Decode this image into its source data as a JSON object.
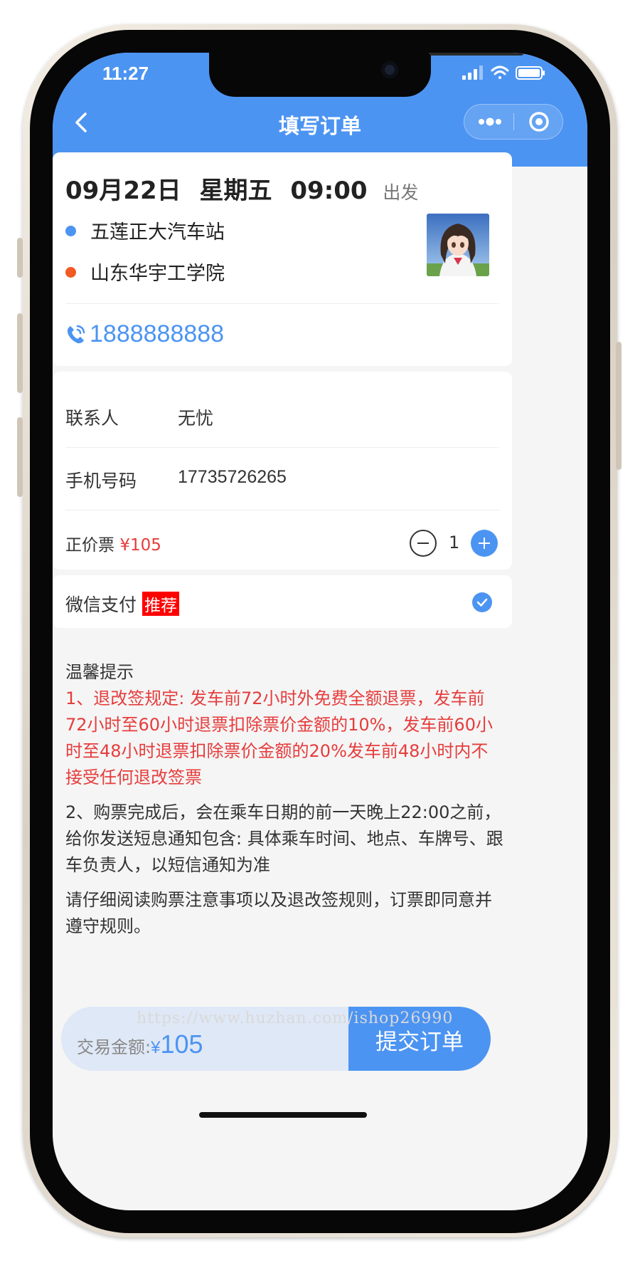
{
  "status_bar": {
    "time": "11:27"
  },
  "nav": {
    "title": "填写订单"
  },
  "trip": {
    "date": "09月22日",
    "weekday": "星期五",
    "time": "09:00",
    "depart_label": "出发",
    "origin": "五莲正大汽车站",
    "destination": "山东华宇工学院",
    "origin_color": "#4c94f2",
    "destination_color": "#f15a22",
    "service_phone": "1888888888"
  },
  "passenger": {
    "contact_label": "联系人",
    "contact_value": "无忧",
    "phone_label": "手机号码",
    "phone_value": "17735726265",
    "ticket_label": "正价票",
    "ticket_price": "¥105",
    "quantity": "1"
  },
  "payment": {
    "method": "微信支付",
    "badge": "推荐",
    "selected": true
  },
  "notice": {
    "heading": "温馨提示",
    "rule_1": "1、退改签规定: 发车前72小时外免费全额退票，发车前72小时至60小时退票扣除票价金额的10%，发车前60小时至48小时退票扣除票价金额的20%发车前48小时内不接受任何退改签票",
    "rule_2": "2、购票完成后，会在乘车日期的前一天晚上22:00之前，给你发送短息通知包含: 具体乘车时间、地点、车牌号、跟车负责人，以短信通知为准",
    "rule_3": "请仔细阅读购票注意事项以及退改签规则，订票即同意并遵守规则。"
  },
  "footer": {
    "amount_label": "交易金额:",
    "currency": "¥",
    "amount": "105",
    "submit_label": "提交订单"
  },
  "watermark": "https://www.huzhan.com/ishop26990",
  "colors": {
    "accent": "#4c94f2",
    "warning_text": "#e63c3c",
    "badge_bg": "#ff0000"
  }
}
